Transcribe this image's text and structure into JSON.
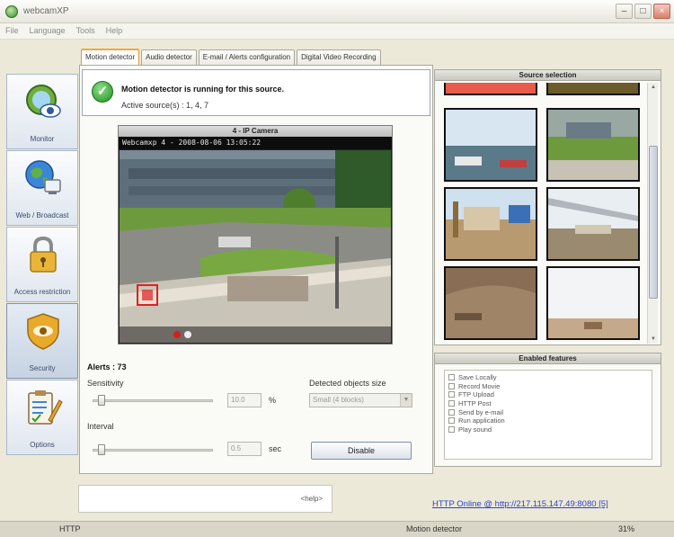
{
  "window": {
    "title": "webcamXP"
  },
  "menu": [
    "File",
    "Language",
    "Tools",
    "Help"
  ],
  "nav": [
    {
      "label": "Monitor",
      "icon": "monitor-eye-icon"
    },
    {
      "label": "Web / Broadcast",
      "icon": "globe-computer-icon"
    },
    {
      "label": "Access restriction",
      "icon": "padlock-icon"
    },
    {
      "label": "Security",
      "icon": "shield-eye-icon"
    },
    {
      "label": "Options",
      "icon": "clipboard-pencil-icon"
    }
  ],
  "tabs": [
    "Motion detector",
    "Audio detector",
    "E-mail / Alerts configuration",
    "Digital Video Recording"
  ],
  "status": {
    "message": "Motion detector is running for this source.",
    "active_sources": "Active source(s) : 1, 4, 7"
  },
  "camera": {
    "title": "4 - IP Camera",
    "timestamp": "Webcamxp 4 - 2008-08-06 13:05:22"
  },
  "detector": {
    "alerts": "Alerts : 73",
    "sensitivity_label": "Sensitivity",
    "sensitivity_value": "10.0",
    "sensitivity_unit": "%",
    "sensitivity_fraction": 0.05,
    "objects_label": "Detected objects size",
    "objects_value": "Small (4 blocks)",
    "interval_label": "Interval",
    "interval_value": "0.5",
    "interval_unit": "sec",
    "interval_fraction": 0.05,
    "disable_label": "Disable"
  },
  "hint": {
    "help_label": "<help>"
  },
  "source_selection": {
    "title": "Source selection"
  },
  "features": {
    "title": "Enabled features",
    "items": [
      "Save Locally",
      "Record Movie",
      "FTP Upload",
      "HTTP Post",
      "Send by e-mail",
      "Run application",
      "Play sound"
    ]
  },
  "http_link": "HTTP Online @ http://217.115.147.49:8080 [5]",
  "statusbar": {
    "protocol": "HTTP",
    "mode": "Motion detector",
    "cpu": "31%"
  },
  "colors": {
    "accent_tab": "#f0a53c",
    "link": "#2a44c8",
    "check_green": "#1f8f1e"
  }
}
